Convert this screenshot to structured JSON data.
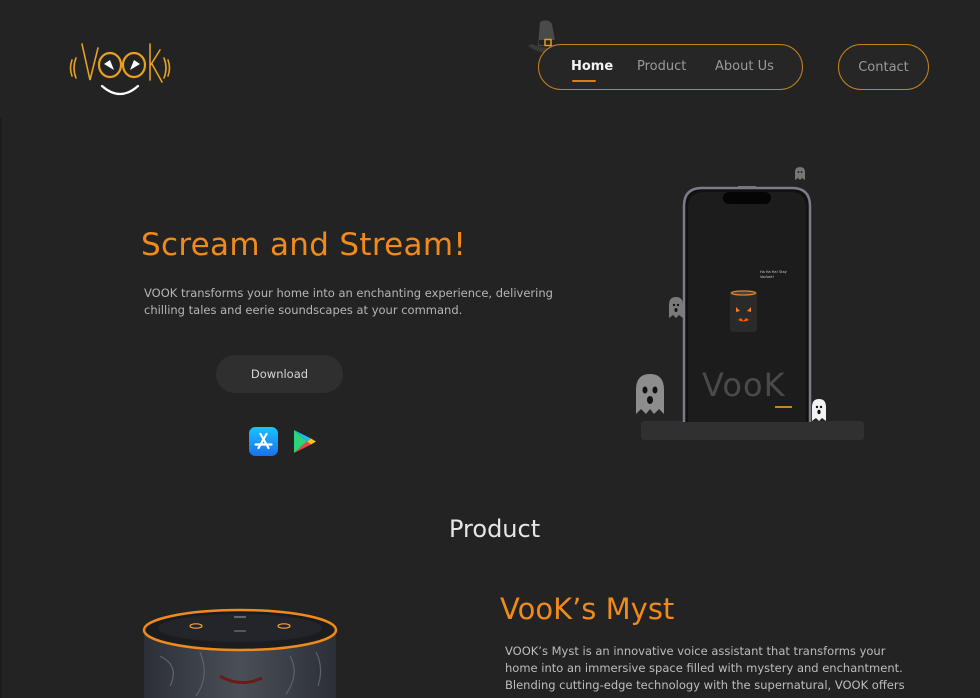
{
  "brand": {
    "logo_text": "VOOK"
  },
  "nav": {
    "items": [
      {
        "label": "Home",
        "active": true
      },
      {
        "label": "Product",
        "active": false
      },
      {
        "label": "About Us",
        "active": false
      }
    ],
    "contact_label": "Contact"
  },
  "hero": {
    "title": "Scream and Stream!",
    "description": "VOOK transforms your home into an enchanting experience, delivering chilling tales and eerie soundscapes at your command.",
    "download_label": "Download",
    "phone_wordmark": "VooK",
    "phone_caption": "Ha Ha Ha! Stay Vocked!",
    "store_icons": [
      "app-store-icon",
      "google-play-icon"
    ]
  },
  "product_section": {
    "title": "Product",
    "product_name": "VooK’s Myst",
    "product_description": "VOOK’s Myst is an innovative voice assistant that transforms your home into an immersive space filled with mystery and enchantment. Blending cutting-edge technology with the supernatural, VOOK offers"
  },
  "colors": {
    "background": "#232323",
    "accent": "#f08a1a",
    "pill_border": "#c8801a"
  }
}
